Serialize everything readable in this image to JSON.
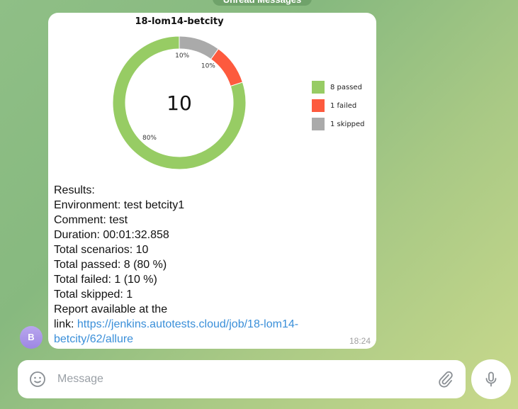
{
  "header": {
    "unread": "Unread Messages"
  },
  "message": {
    "sender_initial": "B",
    "time": "18:24",
    "lines": {
      "results": "Results:",
      "env_label": "Environment:",
      "env": " test betcity1",
      "comment_label": "Comment:",
      "comment": " test",
      "duration_label": "Duration:",
      "duration": " 00:01:32.858",
      "scen_label": "Total scenarios:",
      "scen": " 10",
      "passed_label": "Total passed:",
      "passed": " 8 (80 %)",
      "failed_label": "Total failed:",
      "failed": " 1 (10 %)",
      "skipped_label": "Total skipped:",
      "skipped": " 1",
      "report": "Report available at the",
      "link_label": "link: ",
      "link": "https://jenkins.autotests.cloud/job/18-lom14-betcity/62/allure"
    }
  },
  "chart_data": {
    "type": "pie",
    "title": "18-lom14-betcity",
    "center_label": "10",
    "slices": [
      {
        "name": "1 skipped",
        "value": 1,
        "label": "10%",
        "color": "#aaaaaa"
      },
      {
        "name": "1 failed",
        "value": 1,
        "label": "10%",
        "color": "#fd5a3e"
      },
      {
        "name": "8 passed",
        "value": 8,
        "label": "80%",
        "color": "#97cc64"
      }
    ],
    "legend": [
      "8 passed",
      "1 failed",
      "1 skipped"
    ],
    "legend_colors": [
      "#97cc64",
      "#fd5a3e",
      "#aaaaaa"
    ],
    "legend_position": "right"
  },
  "composer": {
    "placeholder": "Message"
  }
}
